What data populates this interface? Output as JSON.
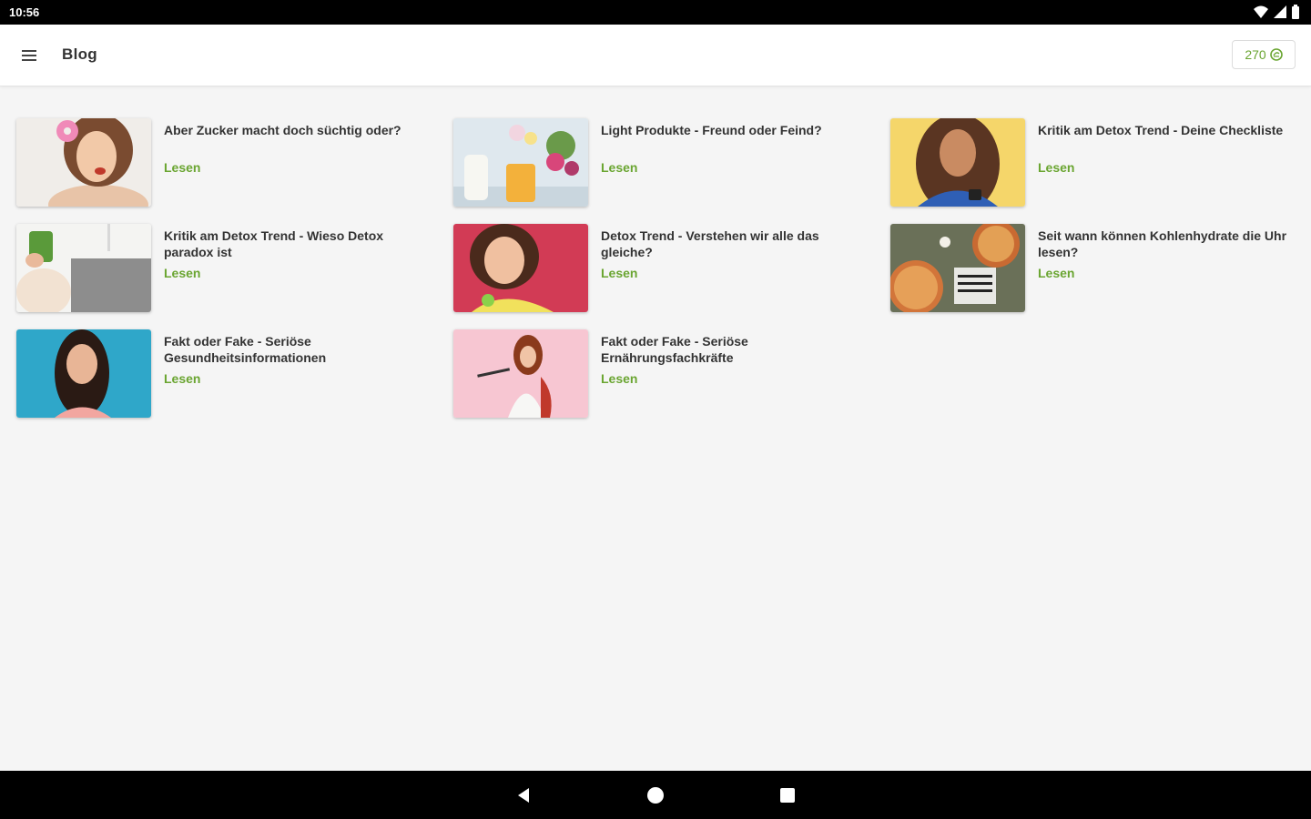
{
  "status_bar": {
    "time": "10:56"
  },
  "app_bar": {
    "title": "Blog",
    "points": "270"
  },
  "articles": [
    {
      "title": "Aber Zucker macht doch süchtig oder?",
      "read_label": "Lesen"
    },
    {
      "title": "Light Produkte - Freund oder Feind?",
      "read_label": "Lesen"
    },
    {
      "title": "Kritik am Detox Trend - Deine Checkliste",
      "read_label": "Lesen"
    },
    {
      "title": "Kritik am Detox Trend - Wieso Detox paradox ist",
      "read_label": "Lesen"
    },
    {
      "title": "Detox Trend - Verstehen wir alle das gleiche?",
      "read_label": "Lesen"
    },
    {
      "title": "Seit wann können Kohlenhydrate die Uhr lesen?",
      "read_label": "Lesen"
    },
    {
      "title": "Fakt oder Fake - Seriöse Gesundheitsinformationen",
      "read_label": "Lesen"
    },
    {
      "title": "Fakt oder Fake - Seriöse Ernährungsfachkräfte",
      "read_label": "Lesen"
    }
  ],
  "colors": {
    "accent": "#6aa531",
    "background": "#f5f5f5"
  }
}
